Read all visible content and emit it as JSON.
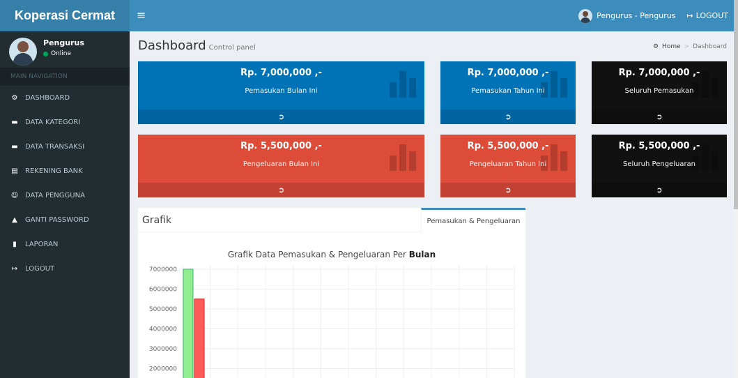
{
  "app": {
    "title": "Koperasi Cermat"
  },
  "header": {
    "menu_icon": "hamburger-icon",
    "user": "Pengurus - Pengurus",
    "logout": "LOGOUT"
  },
  "sidebar": {
    "user_name": "Pengurus",
    "user_status": "Online",
    "nav_header": "MAIN NAVIGATION",
    "items": [
      {
        "label": "DASHBOARD",
        "icon": "dashboard-icon",
        "glyph": "⚙"
      },
      {
        "label": "DATA KATEGORI",
        "icon": "folder-icon",
        "glyph": "▬"
      },
      {
        "label": "DATA TRANSAKSI",
        "icon": "folder-icon",
        "glyph": "▬"
      },
      {
        "label": "REKENING BANK",
        "icon": "bank-book-icon",
        "glyph": "▤"
      },
      {
        "label": "DATA PENGGUNA",
        "icon": "users-icon",
        "glyph": "☺"
      },
      {
        "label": "GANTI PASSWORD",
        "icon": "lock-icon",
        "glyph": "▲"
      },
      {
        "label": "LAPORAN",
        "icon": "document-icon",
        "glyph": "▮"
      },
      {
        "label": "LOGOUT",
        "icon": "sign-out-icon",
        "glyph": "↦"
      }
    ]
  },
  "page": {
    "title": "Dashboard",
    "subtitle": "Control panel",
    "breadcrumb": {
      "home": "Home",
      "current": "Dashboard",
      "separator": ">"
    }
  },
  "boxes": [
    {
      "amount": "Rp. 7,000,000 ,-",
      "label": "Pemasukan Bulan Ini",
      "color": "#0073b7"
    },
    {
      "amount": "Rp. 7,000,000 ,-",
      "label": "Pemasukan Tahun Ini",
      "color": "#0073b7"
    },
    {
      "amount": "Rp. 7,000,000 ,-",
      "label": "Seluruh Pemasukan",
      "color": "#111111"
    },
    {
      "amount": "Rp. 5,500,000 ,-",
      "label": "Pengeluaran Bulan Ini",
      "color": "#dd4b39"
    },
    {
      "amount": "Rp. 5,500,000 ,-",
      "label": "Pengeluaran Tahun Ini",
      "color": "#dd4b39"
    },
    {
      "amount": "Rp. 5,500,000 ,-",
      "label": "Seluruh Pengeluaran",
      "color": "#111111"
    }
  ],
  "panel": {
    "title": "Grafik",
    "tab": "Pemasukan & Pengeluaran",
    "chart_title_prefix": "Grafik Data Pemasukan & Pengeluaran Per",
    "chart_title_bold": "Bulan"
  },
  "chart_data": {
    "type": "bar",
    "title": "Grafik Data Pemasukan & Pengeluaran Per Bulan",
    "y_ticks": [
      7000000,
      6000000,
      5000000,
      4000000,
      3000000,
      2000000
    ],
    "series": [
      {
        "values": [
          7000000
        ],
        "color": "#90ee90"
      },
      {
        "values": [
          5500000
        ],
        "color": "#ff5a5a"
      }
    ],
    "grid": true
  }
}
